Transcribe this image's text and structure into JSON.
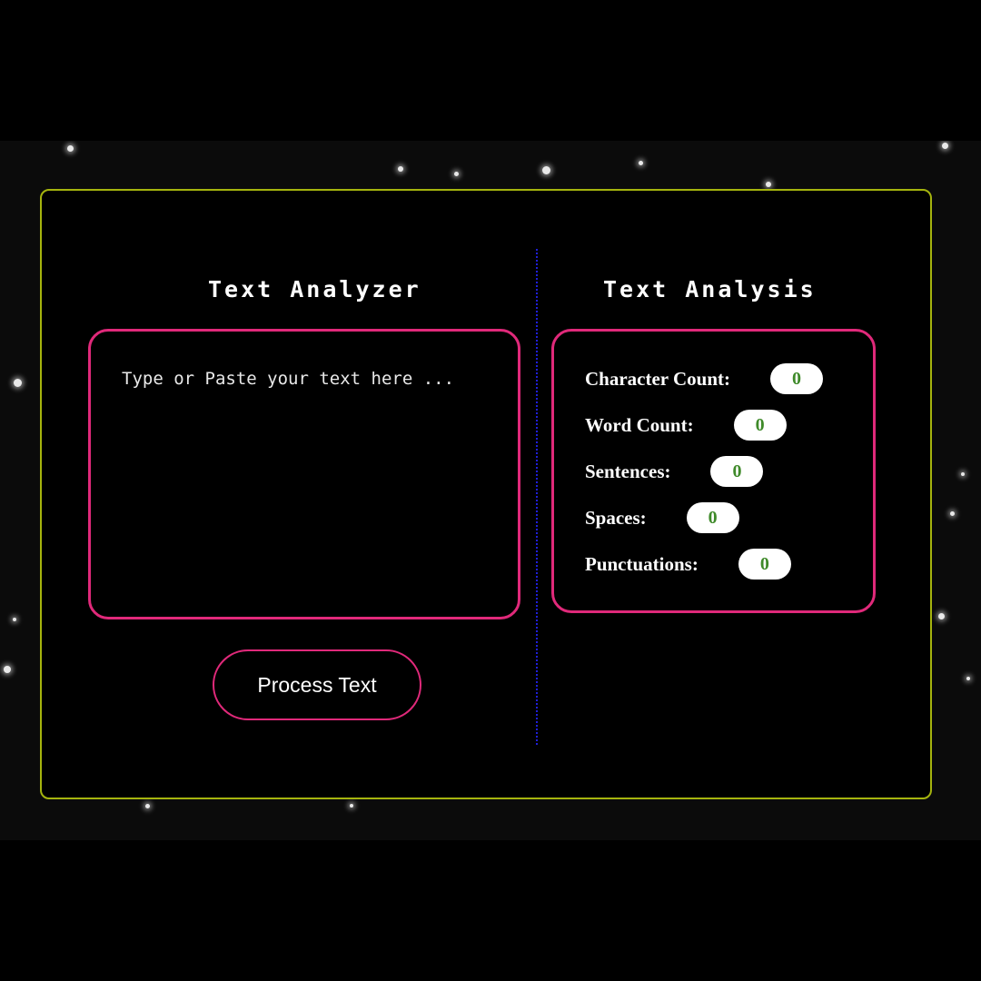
{
  "analyzer": {
    "title": "Text Analyzer",
    "placeholder": "Type or Paste your text here ...",
    "process_button_label": "Process Text"
  },
  "analysis": {
    "title": "Text Analysis",
    "stats": [
      {
        "label": "Character Count:",
        "value": "0"
      },
      {
        "label": "Word Count:",
        "value": "0"
      },
      {
        "label": "Sentences:",
        "value": "0"
      },
      {
        "label": "Spaces:",
        "value": "0"
      },
      {
        "label": "Punctuations:",
        "value": "0"
      }
    ]
  },
  "colors": {
    "panel_border": "#a5b40e",
    "accent_pink": "#e0297a",
    "divider_blue": "#1f1fd8",
    "value_green": "#3f8a2a",
    "background": "#000000"
  }
}
